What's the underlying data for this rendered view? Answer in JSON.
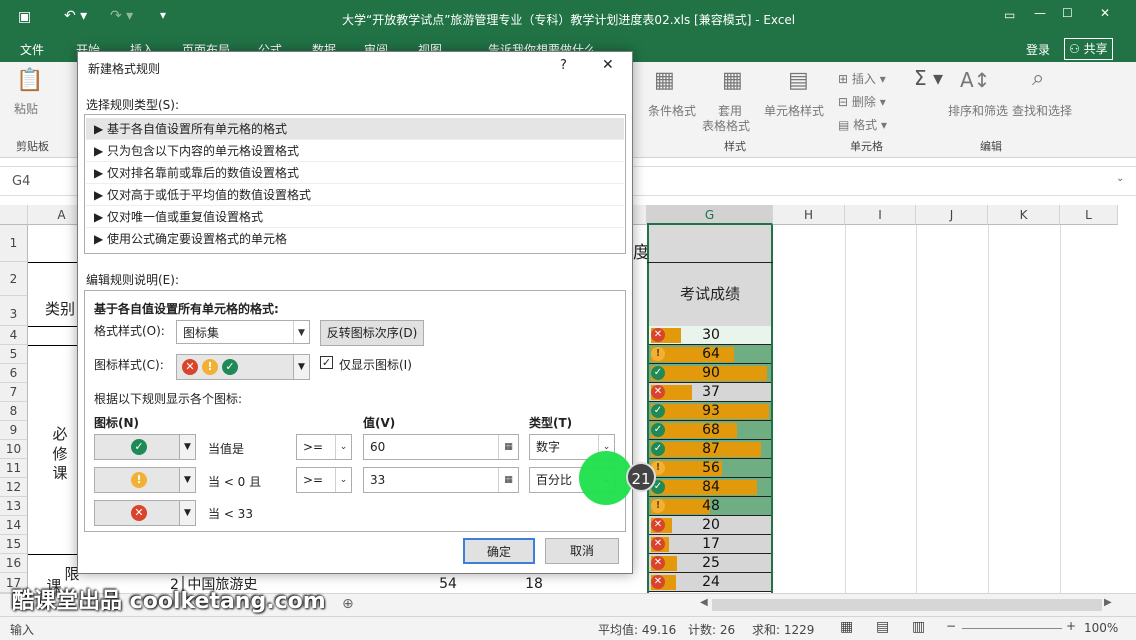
{
  "window": {
    "title": "大学“开放教学试点”旅游管理专业（专科）教学计划进度表02.xls  [兼容模式] - Excel",
    "login": "登录",
    "share": "共享",
    "qa_placeholder": "告诉我你想要做什么..."
  },
  "ribbon_tabs": [
    "文件",
    "开始",
    "插入",
    "页面布局",
    "公式",
    "数据",
    "审阅",
    "视图"
  ],
  "ribbon": {
    "paste": "粘贴",
    "clipboard_group": "剪贴板",
    "cond_format": "条件格式",
    "table_format_1": "套用",
    "table_format_2": "表格格式",
    "cell_style": "单元格样式",
    "styles_group": "样式",
    "insert": "插入",
    "delete": "删除",
    "format": "格式",
    "cells_group": "单元格",
    "sort_filter": "排序和筛选",
    "find_select": "查找和选择",
    "edit_group": "编辑"
  },
  "namebox": "G4",
  "columns": [
    "A",
    "G",
    "H",
    "I",
    "J",
    "K",
    "L"
  ],
  "rows": [
    "1",
    "2",
    "3",
    "4",
    "5",
    "6",
    "7",
    "8",
    "9",
    "10",
    "11",
    "12",
    "13",
    "14",
    "15",
    "16",
    "17"
  ],
  "sheet_text": {
    "title_fragment": "度表",
    "category": "类别",
    "required_1": "必",
    "required_2": "修",
    "required_3": "课",
    "limit": "限",
    "course_char": "课",
    "exam_header": "考试成绩",
    "row17_num": "2",
    "row17_course": "中国旅游史",
    "row17_v1": "54",
    "row17_v2": "18"
  },
  "scores": [
    {
      "value": "30",
      "icon": "bad",
      "pct": 0.25
    },
    {
      "value": "64",
      "icon": "warn",
      "pct": 0.7
    },
    {
      "value": "90",
      "icon": "ok",
      "pct": 0.98
    },
    {
      "value": "37",
      "icon": "bad",
      "pct": 0.35
    },
    {
      "value": "93",
      "icon": "ok",
      "pct": 1.0
    },
    {
      "value": "68",
      "icon": "ok",
      "pct": 0.73
    },
    {
      "value": "87",
      "icon": "ok",
      "pct": 0.93
    },
    {
      "value": "56",
      "icon": "warn",
      "pct": 0.6
    },
    {
      "value": "84",
      "icon": "ok",
      "pct": 0.9
    },
    {
      "value": "48",
      "icon": "warn",
      "pct": 0.5
    },
    {
      "value": "20",
      "icon": "bad",
      "pct": 0.18
    },
    {
      "value": "17",
      "icon": "bad",
      "pct": 0.15
    },
    {
      "value": "25",
      "icon": "bad",
      "pct": 0.22
    },
    {
      "value": "24",
      "icon": "bad",
      "pct": 0.21
    }
  ],
  "status": {
    "mode": "输入",
    "average": "平均值: 49.16",
    "count": "计数: 26",
    "sum": "求和: 1229",
    "zoom": "100%"
  },
  "dialog": {
    "title": "新建格式规则",
    "help": "?",
    "close": "✕",
    "select_rule_type": "选择规则类型(S):",
    "rule_types": [
      "▶ 基于各自值设置所有单元格的格式",
      "▶ 只为包含以下内容的单元格设置格式",
      "▶ 仅对排名靠前或靠后的数值设置格式",
      "▶ 仅对高于或低于平均值的数值设置格式",
      "▶ 仅对唯一值或重复值设置格式",
      "▶ 使用公式确定要设置格式的单元格"
    ],
    "edit_rule_desc": "编辑规则说明(E):",
    "section_title": "基于各自值设置所有单元格的格式:",
    "format_style_label": "格式样式(O):",
    "format_style_value": "图标集",
    "reverse_order": "反转图标次序(D)",
    "icon_style_label": "图标样式(C):",
    "show_icon_only": "仅显示图标(I)",
    "show_icon_only_checked": "✓",
    "display_rule_text": "根据以下规则显示各个图标:",
    "col_icon": "图标(N)",
    "col_value": "值(V)",
    "col_type": "类型(T)",
    "rule1": {
      "desc": "当值是",
      "op": ">=",
      "value": "60",
      "type": "数字"
    },
    "rule2": {
      "desc": "当 < 0 且",
      "op": ">=",
      "value": "33",
      "type": "百分比"
    },
    "rule3": {
      "desc": "当 < 33"
    },
    "ok": "确定",
    "cancel": "取消"
  },
  "overlay": {
    "step": "21",
    "watermark": "酷课堂出品 coolketang.com"
  }
}
